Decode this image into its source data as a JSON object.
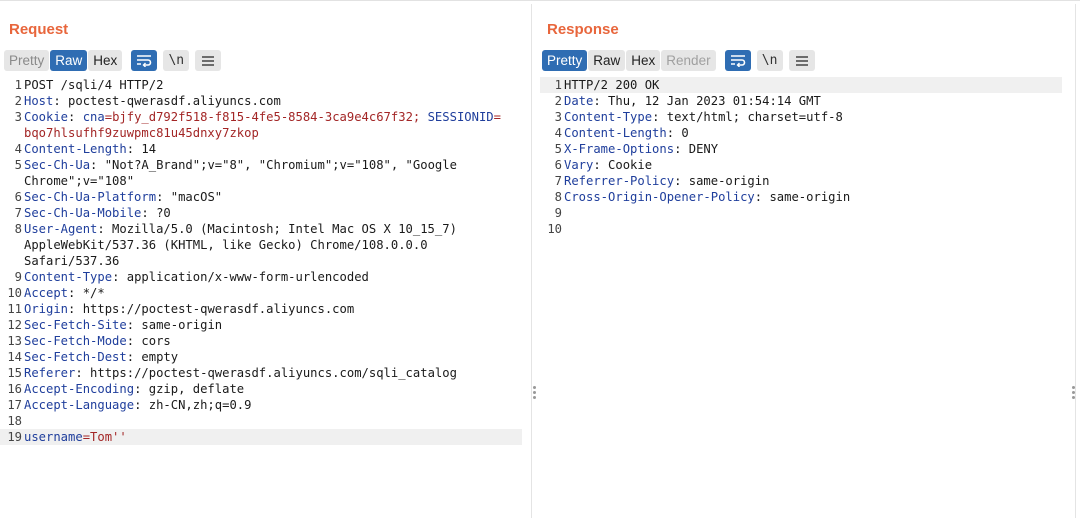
{
  "request": {
    "title": "Request",
    "tabs": [
      "Pretty",
      "Raw",
      "Hex"
    ],
    "active_tab": "Raw",
    "icon_newline": "\\n",
    "lines": [
      {
        "n": "1",
        "plain": "POST /sqli/4 HTTP/2"
      },
      {
        "n": "2",
        "h": "Host",
        "v": ": poctest-qwerasdf.aliyuncs.com"
      },
      {
        "n": "3",
        "h": "Cookie",
        "v": ": ",
        "c1": "cna",
        "c1v": "=bjfy_d792f518-f815-4fe5-8584-3ca9e4c67f32; ",
        "c2": "SESSIONID",
        "c2v": "="
      },
      {
        "n": "",
        "cont": "bqo7hlsufhf9zuwpmc81u45dnxy7zkop",
        "cont_red": true
      },
      {
        "n": "4",
        "h": "Content-Length",
        "v": ": 14"
      },
      {
        "n": "5",
        "h": "Sec-Ch-Ua",
        "v": ": \"Not?A_Brand\";v=\"8\", \"Chromium\";v=\"108\", \"Google"
      },
      {
        "n": "",
        "cont": "Chrome\";v=\"108\""
      },
      {
        "n": "6",
        "h": "Sec-Ch-Ua-Platform",
        "v": ": \"macOS\""
      },
      {
        "n": "7",
        "h": "Sec-Ch-Ua-Mobile",
        "v": ": ?0"
      },
      {
        "n": "8",
        "h": "User-Agent",
        "v": ": Mozilla/5.0 (Macintosh; Intel Mac OS X 10_15_7)"
      },
      {
        "n": "",
        "cont": "AppleWebKit/537.36 (KHTML, like Gecko) Chrome/108.0.0.0"
      },
      {
        "n": "",
        "cont": "Safari/537.36"
      },
      {
        "n": "9",
        "h": "Content-Type",
        "v": ": application/x-www-form-urlencoded"
      },
      {
        "n": "10",
        "h": "Accept",
        "v": ": */*"
      },
      {
        "n": "11",
        "h": "Origin",
        "v": ": https://poctest-qwerasdf.aliyuncs.com"
      },
      {
        "n": "12",
        "h": "Sec-Fetch-Site",
        "v": ": same-origin"
      },
      {
        "n": "13",
        "h": "Sec-Fetch-Mode",
        "v": ": cors"
      },
      {
        "n": "14",
        "h": "Sec-Fetch-Dest",
        "v": ": empty"
      },
      {
        "n": "15",
        "h": "Referer",
        "v": ": https://poctest-qwerasdf.aliyuncs.com/sqli_catalog"
      },
      {
        "n": "16",
        "h": "Accept-Encoding",
        "v": ": gzip, deflate"
      },
      {
        "n": "17",
        "h": "Accept-Language",
        "v": ": zh-CN,zh;q=0.9"
      },
      {
        "n": "18",
        "plain": ""
      },
      {
        "n": "19",
        "p": "username",
        "pv": "=Tom''",
        "hl": true
      }
    ]
  },
  "response": {
    "title": "Response",
    "tabs": [
      "Pretty",
      "Raw",
      "Hex",
      "Render"
    ],
    "active_tab": "Pretty",
    "icon_newline": "\\n",
    "lines": [
      {
        "n": "1",
        "plain": "HTTP/2 200 OK",
        "hl": true
      },
      {
        "n": "2",
        "h": "Date",
        "v": ": Thu, 12 Jan 2023 01:54:14 GMT"
      },
      {
        "n": "3",
        "h": "Content-Type",
        "v": ": text/html; charset=utf-8"
      },
      {
        "n": "4",
        "h": "Content-Length",
        "v": ": 0"
      },
      {
        "n": "5",
        "h": "X-Frame-Options",
        "v": ": DENY"
      },
      {
        "n": "6",
        "h": "Vary",
        "v": ": Cookie"
      },
      {
        "n": "7",
        "h": "Referrer-Policy",
        "v": ": same-origin"
      },
      {
        "n": "8",
        "h": "Cross-Origin-Opener-Policy",
        "v": ": same-origin"
      },
      {
        "n": "9",
        "plain": ""
      },
      {
        "n": "10",
        "plain": ""
      }
    ]
  },
  "colors": {
    "accent_orange": "#e8663c",
    "active_tab_blue": "#2f6db3",
    "header_name_blue": "#1f3e9c",
    "value_red": "#a32626"
  },
  "icons": {
    "wrap": "wrap-lines-icon",
    "newline": "show-newlines-icon",
    "menu": "hamburger-menu-icon",
    "layout_split": "layout-side-by-side-icon",
    "layout_horizontal": "layout-top-bottom-icon",
    "layout_tabs": "layout-tabs-icon"
  }
}
